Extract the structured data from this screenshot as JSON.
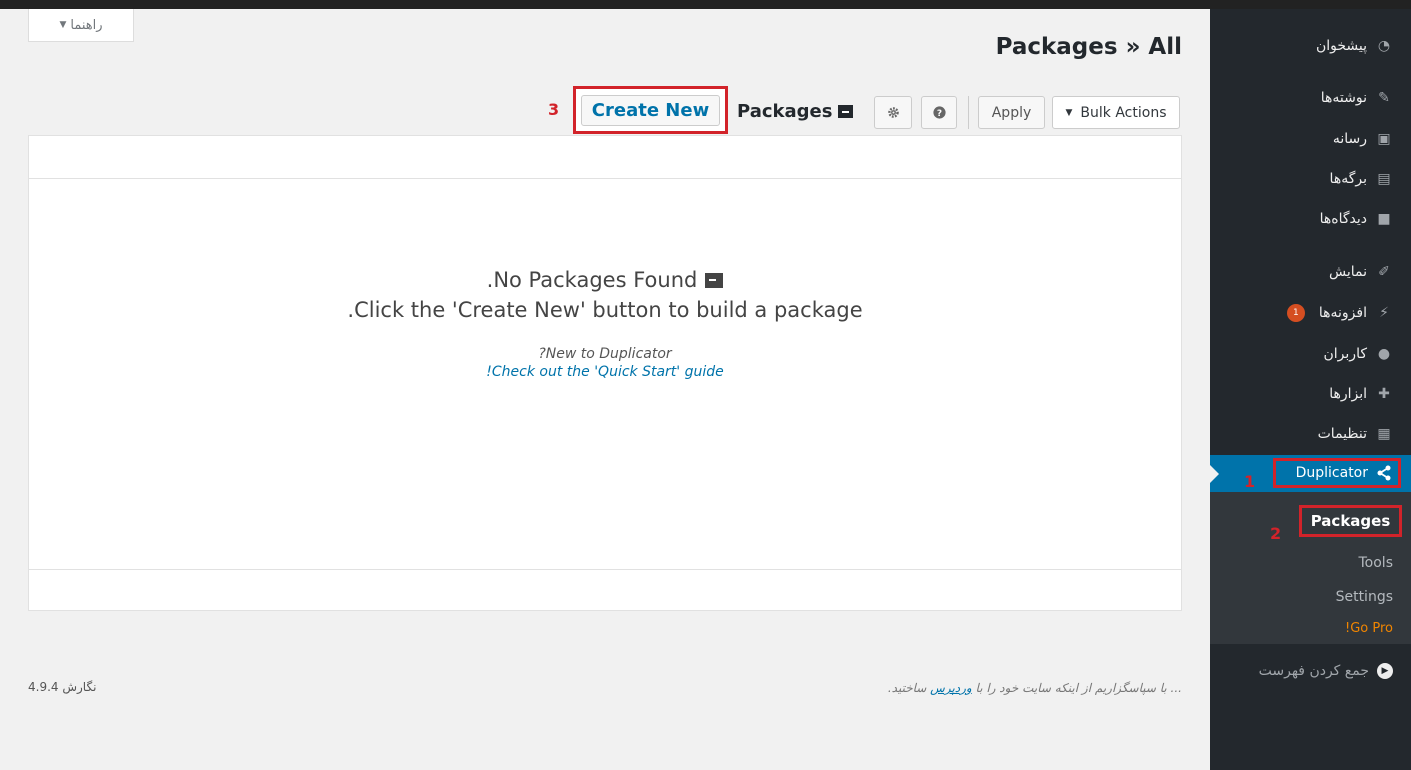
{
  "header": {
    "help_label": "راهنما",
    "page_title": "Packages » All"
  },
  "toolbar": {
    "bulk_actions": "Bulk Actions",
    "apply": "Apply",
    "packages_label": "Packages",
    "create_new": "Create New",
    "annotation_3": "3"
  },
  "empty_state": {
    "line1": ".No Packages Found",
    "line2": ".Click the 'Create New' button to build a package",
    "new_to": "?New to Duplicator",
    "quick_start": "!Check out the 'Quick Start' guide"
  },
  "sidebar": {
    "items": [
      {
        "label": "پیشخوان",
        "icon": "dashboard-icon"
      },
      {
        "label": "نوشته‌ها",
        "icon": "pin-icon"
      },
      {
        "label": "رسانه",
        "icon": "media-icon"
      },
      {
        "label": "برگه‌ها",
        "icon": "page-icon"
      },
      {
        "label": "دیدگاه‌ها",
        "icon": "comment-icon"
      },
      {
        "label": "نمایش",
        "icon": "appearance-icon"
      },
      {
        "label": "افزونه‌ها",
        "icon": "plugin-icon",
        "badge": "1"
      },
      {
        "label": "کاربران",
        "icon": "user-icon"
      },
      {
        "label": "ابزارها",
        "icon": "wrench-icon"
      },
      {
        "label": "تنظیمات",
        "icon": "settings-icon"
      }
    ],
    "duplicator": "Duplicator",
    "annotation_1": "1",
    "submenu": {
      "packages": "Packages",
      "tools": "Tools",
      "settings": "Settings",
      "go_pro": "!Go Pro"
    },
    "annotation_2": "2",
    "collapse": "جمع کردن فهرست"
  },
  "footer": {
    "thanks_before": "... با سپاسگزاریم از اینکه سایت خود را با",
    "thanks_link": "وردپرس",
    "thanks_after": "ساختید.",
    "version": "نگارش 4.9.4"
  },
  "colors": {
    "sidebar_bg": "#23282d",
    "active_bg": "#0073aa",
    "highlight_red": "#d2232a",
    "go_pro": "#f18500",
    "link": "#0073aa"
  }
}
